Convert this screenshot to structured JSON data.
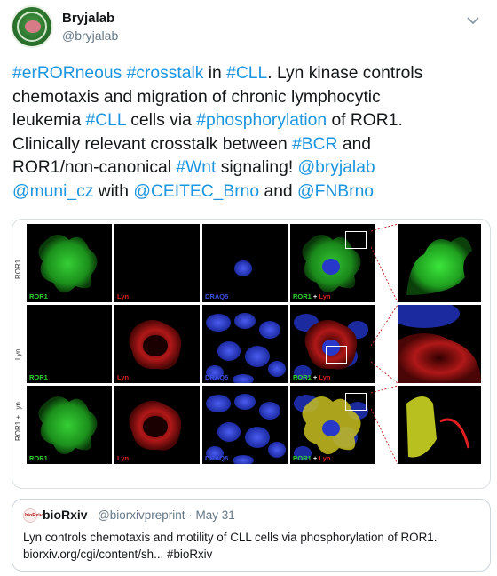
{
  "author": {
    "name": "Bryjalab",
    "handle": "@bryjalab"
  },
  "tweet": {
    "lines": [
      [
        {
          "t": "#erRORneous",
          "tag": true
        },
        {
          "t": " ",
          "tag": false
        },
        {
          "t": "#crosstalk",
          "tag": true
        },
        {
          "t": " in ",
          "tag": false
        },
        {
          "t": "#CLL",
          "tag": true
        },
        {
          "t": ". Lyn kinase controls",
          "tag": false
        }
      ],
      [
        {
          "t": "chemotaxis and migration of chronic lymphocytic",
          "tag": false
        }
      ],
      [
        {
          "t": "leukemia ",
          "tag": false
        },
        {
          "t": "#CLL",
          "tag": true
        },
        {
          "t": " cells via ",
          "tag": false
        },
        {
          "t": "#phosphorylation",
          "tag": true
        },
        {
          "t": " of ROR1.",
          "tag": false
        }
      ],
      [
        {
          "t": "Clinically relevant crosstalk between ",
          "tag": false
        },
        {
          "t": "#BCR",
          "tag": true
        },
        {
          "t": " and",
          "tag": false
        }
      ],
      [
        {
          "t": "ROR1/non-canonical ",
          "tag": false
        },
        {
          "t": "#Wnt",
          "tag": true
        },
        {
          "t": " signaling! ",
          "tag": false
        },
        {
          "t": "@bryjalab",
          "tag": true
        }
      ],
      [
        {
          "t": "@muni_cz",
          "tag": true
        },
        {
          "t": " with ",
          "tag": false
        },
        {
          "t": "@CEITEC_Brno",
          "tag": true
        },
        {
          "t": " and ",
          "tag": false
        },
        {
          "t": "@FNBrno",
          "tag": true
        }
      ]
    ]
  },
  "figure": {
    "row_labels": [
      "ROR1",
      "Lyn",
      "ROR1 + Lyn"
    ],
    "panels": [
      [
        "ROR1",
        "Lyn",
        "DRAQ5",
        "ROR1 + Lyn"
      ],
      [
        "ROR1",
        "Lyn",
        "DRAQ5",
        "ROR1 + Lyn"
      ],
      [
        "ROR1",
        "Lyn",
        "DRAQ5",
        "ROR1 + Lyn"
      ]
    ],
    "colors": {
      "ror1": "#2fd62f",
      "lyn": "#e02020",
      "draq5": "#3c4fe0",
      "merge_ror1": "#2fd62f",
      "merge_lyn": "#e02020"
    }
  },
  "quote": {
    "source_name": "bioRxiv",
    "logo_text": "bioRxiv",
    "meta": "@biorxivpreprint · May 31",
    "line1": "Lyn controls chemotaxis and motility of CLL cells via phosphorylation of ROR1.",
    "line2": "biorxiv.org/cgi/content/sh... #bioRxiv"
  }
}
